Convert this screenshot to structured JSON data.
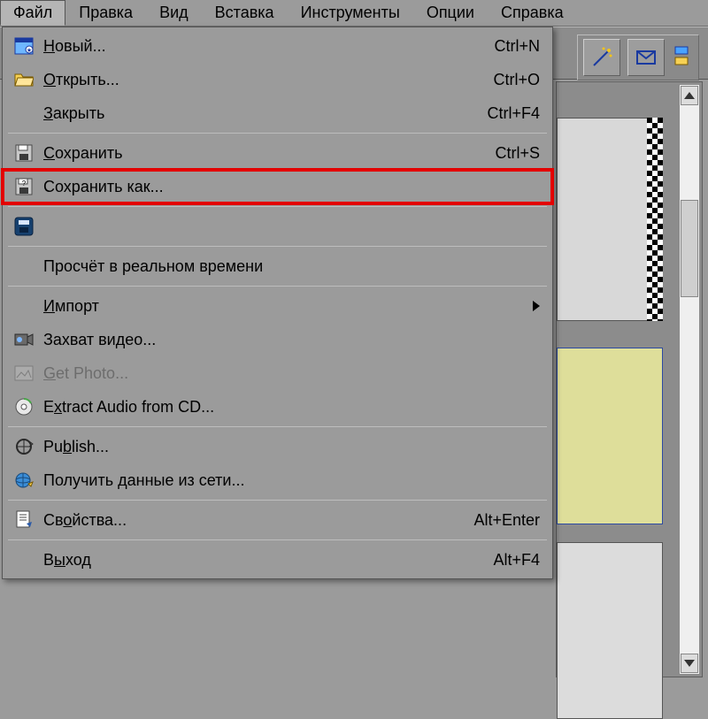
{
  "menubar": {
    "items": [
      {
        "label": "Файл",
        "active": true
      },
      {
        "label": "Правка"
      },
      {
        "label": "Вид"
      },
      {
        "label": "Вставка"
      },
      {
        "label": "Инструменты"
      },
      {
        "label": "Опции"
      },
      {
        "label": "Справка"
      }
    ]
  },
  "file_menu": {
    "items": [
      {
        "label": "Новый...",
        "shortcut": "Ctrl+N",
        "icon": "new-window-icon",
        "ul": 0
      },
      {
        "label": "Открыть...",
        "shortcut": "Ctrl+O",
        "icon": "folder-open-icon",
        "ul": 0
      },
      {
        "label": "Закрыть",
        "shortcut": "Ctrl+F4",
        "icon": "",
        "ul": 0
      },
      {
        "sep": true
      },
      {
        "label": "Сохранить",
        "shortcut": "Ctrl+S",
        "icon": "floppy-icon",
        "ul": 0
      },
      {
        "label": "Сохранить как...",
        "shortcut": "",
        "icon": "floppy-prompt-icon",
        "highlight": true
      },
      {
        "sep": true
      },
      {
        "label": "",
        "shortcut": "",
        "icon": "compact-save-icon",
        "iconOnly": true
      },
      {
        "sep": true
      },
      {
        "label": "Просчёт в реальном времени",
        "shortcut": "",
        "icon": ""
      },
      {
        "sep": true
      },
      {
        "label": "Импорт",
        "shortcut": "",
        "icon": "",
        "submenu": true,
        "ul": 0
      },
      {
        "label": "Захват видео...",
        "shortcut": "",
        "icon": "capture-icon"
      },
      {
        "label": "Get Photo...",
        "shortcut": "",
        "icon": "photo-icon",
        "disabled": true,
        "ul": 0
      },
      {
        "label": "Extract Audio from CD...",
        "shortcut": "",
        "icon": "cd-icon",
        "ul": 1
      },
      {
        "sep": true
      },
      {
        "label": "Publish...",
        "shortcut": "",
        "icon": "publish-icon",
        "ul": 2
      },
      {
        "label": "Получить данные из сети...",
        "shortcut": "",
        "icon": "net-icon"
      },
      {
        "sep": true
      },
      {
        "label": "Свойства...",
        "shortcut": "Alt+Enter",
        "icon": "properties-icon",
        "ul": 2
      },
      {
        "sep": true
      },
      {
        "label": "Выход",
        "shortcut": "Alt+F4",
        "icon": "",
        "ul": 1
      }
    ]
  },
  "colors": {
    "highlight": "#e30000",
    "panel": "#8c8c8c"
  }
}
